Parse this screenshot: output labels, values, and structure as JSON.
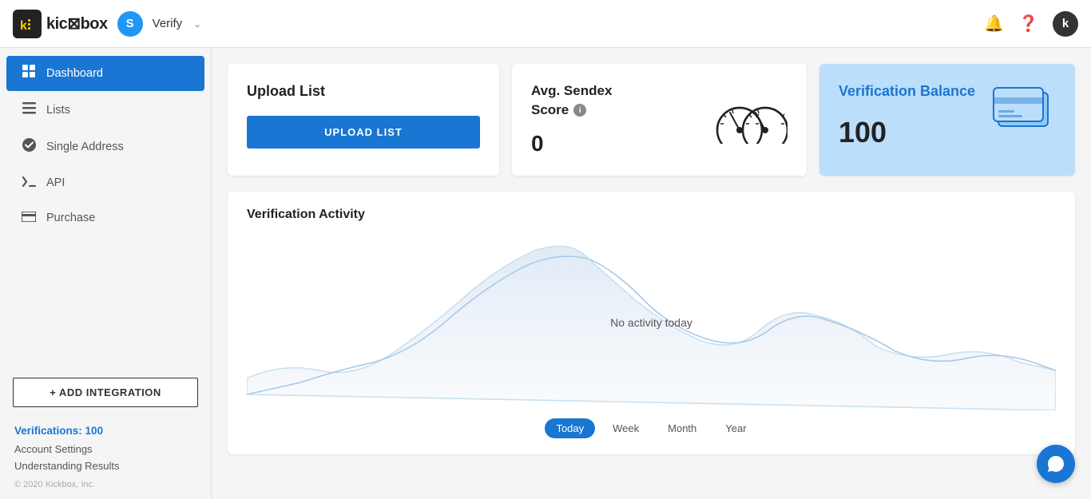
{
  "app": {
    "logo_text": "kickbox",
    "logo_initial": "k"
  },
  "workspace": {
    "initial": "S",
    "name": "Verify",
    "chevron": "⌃"
  },
  "topnav": {
    "bell_icon": "🔔",
    "help_icon": "❓",
    "user_icon": "k"
  },
  "sidebar": {
    "items": [
      {
        "id": "dashboard",
        "label": "Dashboard",
        "icon": "▦",
        "active": true
      },
      {
        "id": "lists",
        "label": "Lists",
        "icon": "☰",
        "active": false
      },
      {
        "id": "single-address",
        "label": "Single Address",
        "icon": "✔",
        "active": false
      },
      {
        "id": "api",
        "label": "API",
        "icon": "<>",
        "active": false
      },
      {
        "id": "purchase",
        "label": "Purchase",
        "icon": "▬",
        "active": false
      }
    ],
    "add_integration_label": "+ ADD INTEGRATION",
    "verifications_label": "Verifications:",
    "verifications_count": "100",
    "footer_links": [
      "Account Settings",
      "Understanding Results"
    ],
    "copyright": "© 2020 Kickbox, Inc."
  },
  "cards": {
    "upload": {
      "title": "Upload List",
      "button_label": "UPLOAD LIST"
    },
    "sendex": {
      "title_line1": "Avg. Sendex",
      "title_line2": "Score",
      "score": "0"
    },
    "balance": {
      "title": "Verification Balance",
      "amount": "100"
    }
  },
  "activity": {
    "title": "Verification Activity",
    "no_activity_text": "No activity today",
    "time_filters": [
      {
        "label": "Today",
        "active": true
      },
      {
        "label": "Week",
        "active": false
      },
      {
        "label": "Month",
        "active": false
      },
      {
        "label": "Year",
        "active": false
      }
    ]
  },
  "chat_bubble_icon": "💬"
}
